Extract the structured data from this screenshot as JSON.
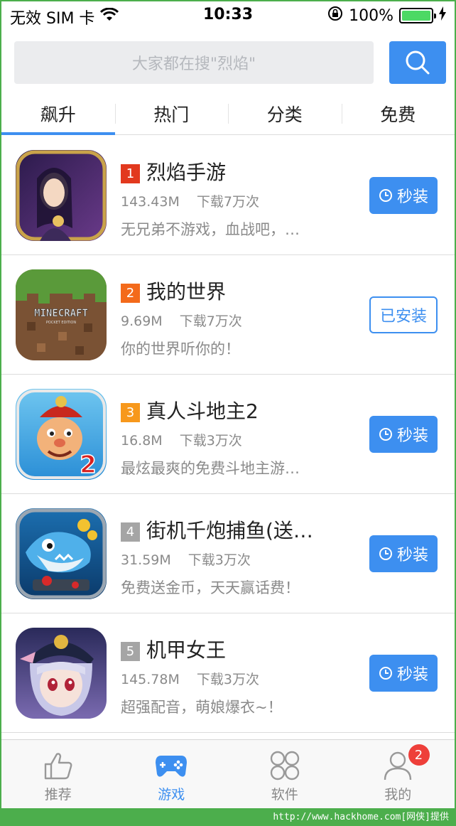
{
  "status_bar": {
    "carrier": "无效 SIM 卡",
    "time": "10:33",
    "battery_percent": "100%",
    "battery_level": 1.0
  },
  "search": {
    "placeholder": "大家都在搜\"烈焰\""
  },
  "tabs": [
    {
      "label": "飙升",
      "active": true
    },
    {
      "label": "热门",
      "active": false
    },
    {
      "label": "分类",
      "active": false
    },
    {
      "label": "免费",
      "active": false
    }
  ],
  "apps": [
    {
      "rank": "1",
      "rank_color": "#e2391e",
      "name": "烈焰手游",
      "size": "143.43M",
      "downloads": "下载7万次",
      "desc": "无兄弟不游戏，血战吧，…",
      "action": "秒装",
      "installed": false,
      "icon": "game-pk-icon"
    },
    {
      "rank": "2",
      "rank_color": "#f36a1b",
      "name": "我的世界",
      "size": "9.69M",
      "downloads": "下载7万次",
      "desc": "你的世界听你的！",
      "action": "已安装",
      "installed": true,
      "icon": "minecraft-icon"
    },
    {
      "rank": "3",
      "rank_color": "#f7981c",
      "name": "真人斗地主2",
      "size": "16.8M",
      "downloads": "下载3万次",
      "desc": "最炫最爽的免费斗地主游…",
      "action": "秒装",
      "installed": false,
      "icon": "landlord-icon"
    },
    {
      "rank": "4",
      "rank_color": "#a5a5a5",
      "name": "街机千炮捕鱼(送…",
      "size": "31.59M",
      "downloads": "下载3万次",
      "desc": "免费送金币，天天赢话费！",
      "action": "秒装",
      "installed": false,
      "icon": "fishing-icon"
    },
    {
      "rank": "5",
      "rank_color": "#a5a5a5",
      "name": "机甲女王",
      "size": "145.78M",
      "downloads": "下载3万次",
      "desc": "超强配音，萌娘爆衣~！",
      "action": "秒装",
      "installed": false,
      "icon": "mecha-queen-icon"
    }
  ],
  "tabbar": [
    {
      "label": "推荐",
      "icon": "thumbs-up-icon",
      "active": false
    },
    {
      "label": "游戏",
      "icon": "gamepad-icon",
      "active": true
    },
    {
      "label": "软件",
      "icon": "apps-grid-icon",
      "active": false
    },
    {
      "label": "我的",
      "icon": "user-icon",
      "active": false,
      "badge": "2"
    }
  ],
  "colors": {
    "accent": "#3d8ff0",
    "frame": "#4cae4c"
  },
  "watermark": "http://www.hackhome.com[网侠]提供"
}
